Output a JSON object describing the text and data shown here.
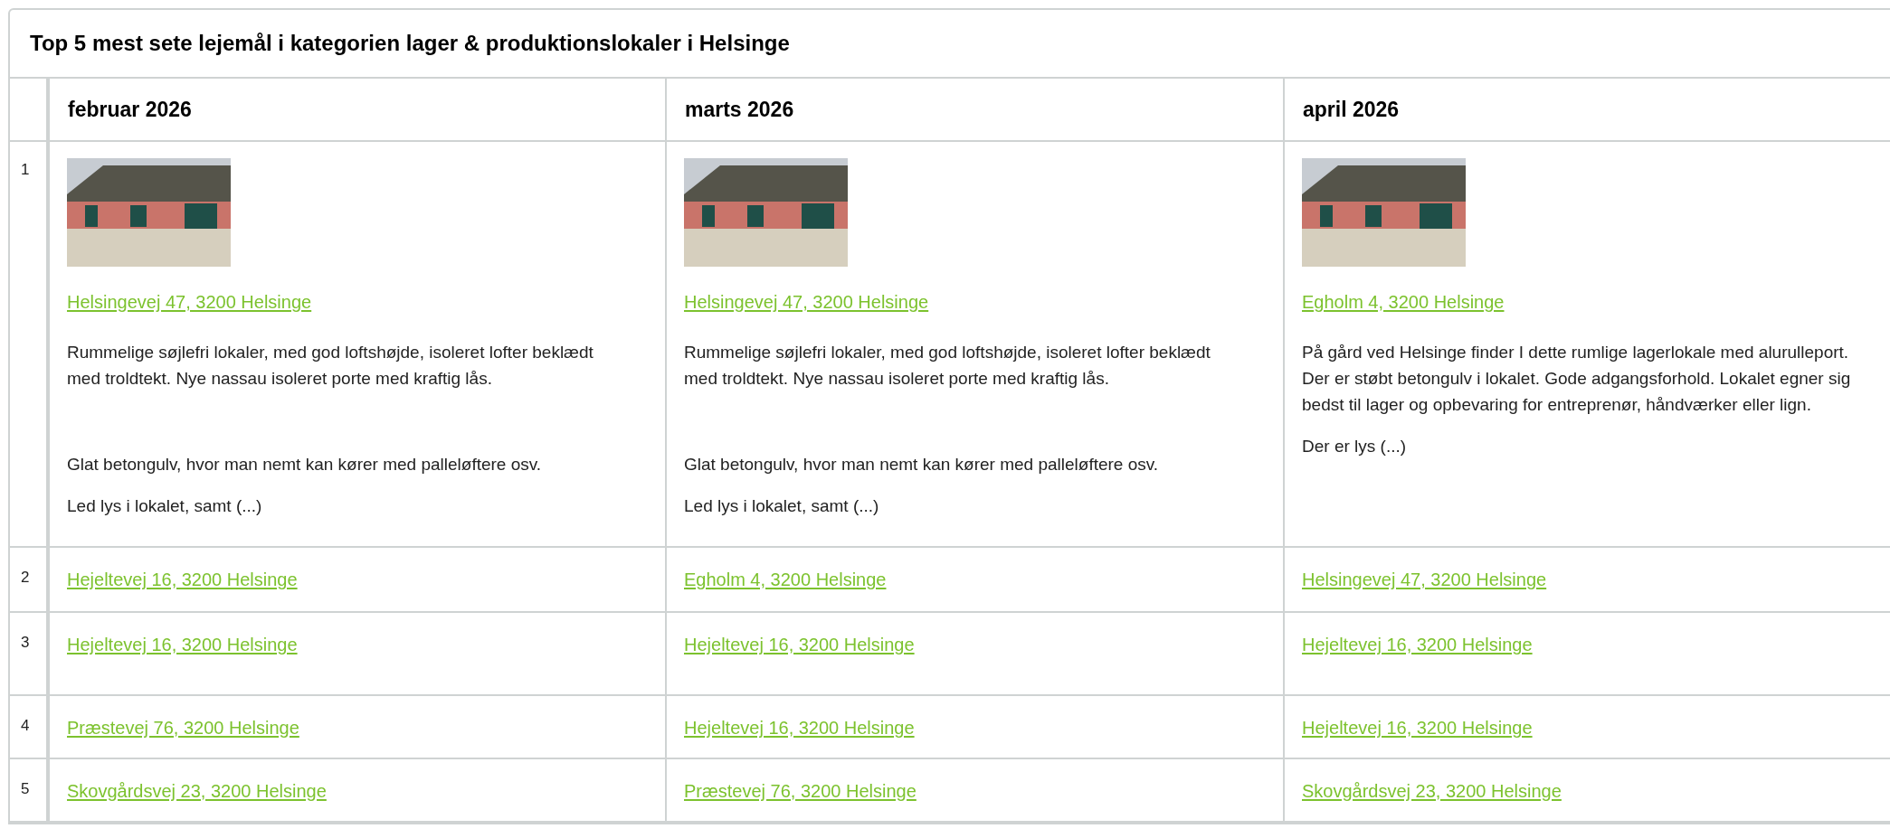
{
  "title": "Top 5 mest sete lejemål i kategorien lager & produktionslokaler i Helsinge",
  "columns": [
    {
      "label": "februar 2026"
    },
    {
      "label": "marts 2026"
    },
    {
      "label": "april 2026"
    }
  ],
  "rows": [
    {
      "rank": "1",
      "cells": [
        {
          "kind": "featured",
          "address": "Helsingevej 47, 3200 Helsinge",
          "paragraphs": [
            {
              "text": "Rummelige søjlefri lokaler, med god loftshøjde, isoleret lofter beklædt med troldtekt. Nye nassau isoleret porte med kraftig lås.",
              "gap_before": false
            },
            {
              "text": "Glat betongulv, hvor man nemt kan kører med palleløftere osv.",
              "gap_before": true
            },
            {
              "text": "Led lys i lokalet, samt (...)",
              "gap_before": false
            }
          ]
        },
        {
          "kind": "featured",
          "address": "Helsingevej 47, 3200 Helsinge",
          "paragraphs": [
            {
              "text": "Rummelige søjlefri lokaler, med god loftshøjde, isoleret lofter beklædt med troldtekt. Nye nassau isoleret porte med kraftig lås.",
              "gap_before": false
            },
            {
              "text": "Glat betongulv, hvor man nemt kan kører med palleløftere osv.",
              "gap_before": true
            },
            {
              "text": "Led lys i lokalet, samt (...)",
              "gap_before": false
            }
          ]
        },
        {
          "kind": "featured",
          "address": "Egholm 4, 3200 Helsinge",
          "paragraphs": [
            {
              "text": "På gård ved Helsinge finder I dette rumlige lagerlokale med alurulleport. Der er støbt betongulv i lokalet. Gode adgangsforhold. Lokalet egner sig bedst til lager og opbevaring for entreprenør, håndværker eller lign.",
              "gap_before": false
            },
            {
              "text": "Der er lys (...)",
              "gap_before": false
            }
          ]
        }
      ]
    },
    {
      "rank": "2",
      "cells": [
        {
          "kind": "link",
          "address": "Hejeltevej 16, 3200 Helsinge"
        },
        {
          "kind": "link",
          "address": "Egholm 4, 3200 Helsinge"
        },
        {
          "kind": "link",
          "address": "Helsingevej 47, 3200 Helsinge"
        }
      ]
    },
    {
      "rank": "3",
      "cells": [
        {
          "kind": "link",
          "address": "Hejeltevej 16, 3200 Helsinge"
        },
        {
          "kind": "link",
          "address": "Hejeltevej 16, 3200 Helsinge"
        },
        {
          "kind": "link",
          "address": "Hejeltevej 16, 3200 Helsinge"
        }
      ]
    },
    {
      "rank": "4",
      "cells": [
        {
          "kind": "link",
          "address": "Præstevej 76, 3200 Helsinge"
        },
        {
          "kind": "link",
          "address": "Hejeltevej 16, 3200 Helsinge"
        },
        {
          "kind": "link",
          "address": "Hejeltevej 16, 3200 Helsinge"
        }
      ]
    },
    {
      "rank": "5",
      "cells": [
        {
          "kind": "link",
          "address": "Skovgårdsvej 23, 3200 Helsinge"
        },
        {
          "kind": "link",
          "address": "Præstevej 76, 3200 Helsinge"
        },
        {
          "kind": "link",
          "address": "Skovgårdsvej 23, 3200 Helsinge"
        }
      ]
    }
  ]
}
